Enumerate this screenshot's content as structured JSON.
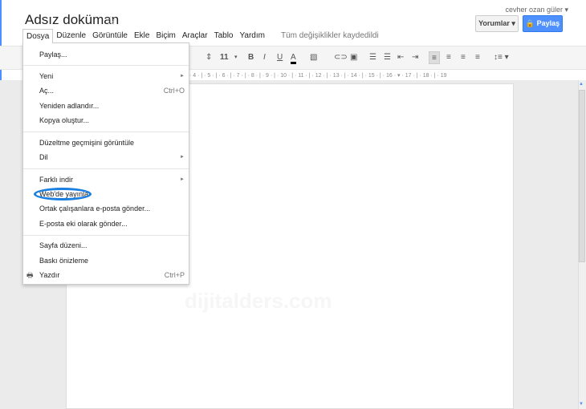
{
  "doc": {
    "title": "Adsız doküman",
    "user": "cevher ozan güler ▾",
    "comments": "Yorumlar ▾",
    "share": "🔒 Paylaş",
    "saved": "Tüm değişiklikler kaydedildi",
    "watermark": "dijitalders.com"
  },
  "menubar": [
    "Dosya",
    "Düzenle",
    "Görüntüle",
    "Ekle",
    "Biçim",
    "Araçlar",
    "Tablo",
    "Yardım"
  ],
  "toolbar": {
    "font_size": "11",
    "ruler": "· 4 · | · 5 · | · 6 · | · 7 · | · 8 · | · 9 · | · 10 · | · 11 · | · 12 · | · 13 · | · 14 · | · 15 · | · 16 · ▾ · 17 · | · 18 · | · 19"
  },
  "file_menu": [
    {
      "label": "Paylaş..."
    },
    {
      "label": "Yeni",
      "shortcut": "►"
    },
    {
      "label": "Aç...",
      "shortcut": "Ctrl+O"
    },
    {
      "label": "Yeniden adlandır..."
    },
    {
      "label": "Kopya oluştur..."
    },
    {
      "label": "Düzeltme geçmişini görüntüle"
    },
    {
      "label": "Dil",
      "shortcut": "►"
    },
    {
      "label": "Farklı indir",
      "shortcut": "►"
    },
    {
      "label": "Web'de yayınla"
    },
    {
      "label": "Ortak çalışanlara e-posta gönder..."
    },
    {
      "label": "E-posta eki olarak gönder..."
    },
    {
      "label": "Sayfa düzeni..."
    },
    {
      "label": "Baskı önizleme"
    },
    {
      "label": "Yazdır",
      "shortcut": "Ctrl+P",
      "icon": "printer-icon"
    }
  ],
  "colors": {
    "accent": "#4d90fe",
    "highlight_circle": "#1a7fe0"
  }
}
